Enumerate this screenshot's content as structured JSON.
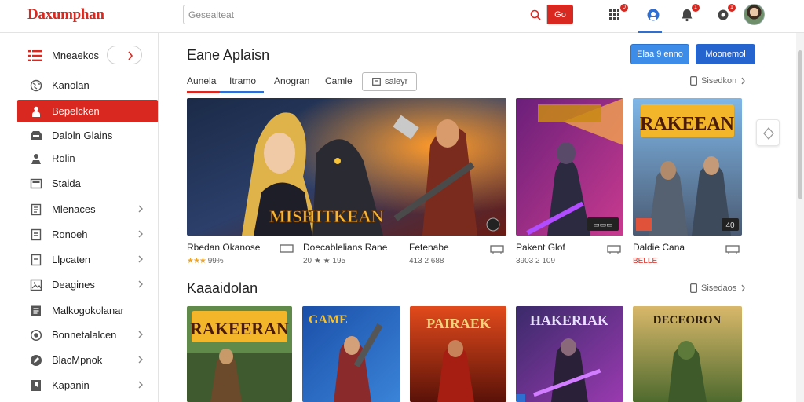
{
  "header": {
    "logo": "Daxumphan",
    "search_placeholder": "Gesealteat",
    "search_button": "Go",
    "icons": [
      {
        "name": "apps-icon",
        "badge": "0"
      },
      {
        "name": "controller-icon",
        "badge": ""
      },
      {
        "name": "bell-icon",
        "badge": "1"
      },
      {
        "name": "settings-icon",
        "badge": "1"
      }
    ]
  },
  "sidebar": {
    "title": "Mneaekos",
    "items": [
      {
        "label": "Kanolan",
        "icon": "globe-icon",
        "arrow": false
      },
      {
        "label": "Bepelcken",
        "icon": "person-icon",
        "arrow": false,
        "active": true
      },
      {
        "label": "Daloln Glains",
        "icon": "tray-icon",
        "arrow": false
      },
      {
        "label": "Rolin",
        "icon": "user-icon",
        "arrow": false
      },
      {
        "label": "Staida",
        "icon": "card-icon",
        "arrow": false
      },
      {
        "label": "Mlenaces",
        "icon": "document-icon",
        "arrow": true
      },
      {
        "label": "Ronoeh",
        "icon": "list-icon",
        "arrow": true
      },
      {
        "label": "Llpcaten",
        "icon": "page-icon",
        "arrow": true
      },
      {
        "label": "Deagines",
        "icon": "image-icon",
        "arrow": true
      },
      {
        "label": "Malkogokolanar",
        "icon": "notes-icon",
        "arrow": false
      },
      {
        "label": "Bonnetalalcen",
        "icon": "target-icon",
        "arrow": true
      },
      {
        "label": "BlacMpnok",
        "icon": "pencil-icon",
        "arrow": true
      },
      {
        "label": "Kapanin",
        "icon": "bookmark-icon",
        "arrow": true
      }
    ]
  },
  "main": {
    "title": "Eane Aplaisn",
    "buttons": {
      "primary": "Elaa 9 enno",
      "secondary": "Moonemol"
    },
    "tabs": [
      {
        "label": "Aunela",
        "active": true,
        "color": "#d8281f"
      },
      {
        "label": "Itramo",
        "active": true,
        "color": "#2f6fd1"
      },
      {
        "label": "Anogran",
        "active": false
      },
      {
        "label": "Camle",
        "active": false
      }
    ],
    "filter_label": "saleyr",
    "see_more": "Sisedkon",
    "featured": [
      {
        "title": "Rbedan Okanose",
        "meta": "99%",
        "stars": "★★★",
        "art": "MISHITKEAN",
        "badge": ""
      },
      {
        "title": "Doecablelians Rane",
        "meta": "20 ★ ★ 195",
        "stars": "",
        "art": "",
        "badge": ""
      },
      {
        "title": "Fetenabe",
        "meta": "413 2 688",
        "stars": "",
        "art": "",
        "badge": ""
      },
      {
        "title": "Pakent Glof",
        "meta": "3903 2 109",
        "stars": "",
        "art": "",
        "badge": "▭▭▭"
      },
      {
        "title": "Daldie Cana",
        "meta": "BELLE",
        "stars": "",
        "art": "RAKEEAN",
        "badge": "40"
      }
    ],
    "section2": {
      "title": "Kaaaidolan",
      "see_more": "Sisedaos",
      "games": [
        {
          "art": "RAKEERAN",
          "tag": ""
        },
        {
          "art": "GAME",
          "tag": ""
        },
        {
          "art": "PAIRAEK",
          "tag": ""
        },
        {
          "art": "HAKERIAK",
          "tag": ""
        },
        {
          "art": "DECEORON",
          "tag": ""
        }
      ]
    }
  },
  "colors": {
    "accent": "#d8281f",
    "blue": "#2563cf",
    "star": "#f2a51c"
  }
}
